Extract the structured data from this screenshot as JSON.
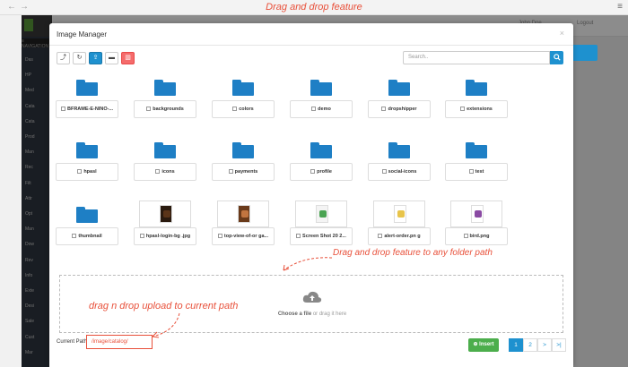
{
  "browser": {
    "back": "←",
    "forward": "→",
    "banner": "Drag and drop feature",
    "menu": "≡"
  },
  "app": {
    "logo": "HALAL PRO",
    "nav_header": "≡ NAVIGATION",
    "sidebar_items": [
      "Das",
      "HP",
      "Med",
      "Cata",
      "Cata",
      "Prod",
      "Man",
      "Rec",
      "Filt",
      "Attr",
      "Opt",
      "Man",
      "Dow",
      "Rev",
      "Info",
      "Exte",
      "Desi",
      "Sale",
      "Cust",
      "Mar"
    ],
    "user_name": "John Doe",
    "logout": "Logout"
  },
  "modal": {
    "title": "Image Manager",
    "close": "×",
    "toolbar": {
      "up": "⤴",
      "refresh": "↻",
      "upload": "⇪",
      "new_folder": "▬",
      "delete": "▥"
    },
    "search": {
      "placeholder": "Search.."
    },
    "items": [
      {
        "name": "BFRAME-E-NINO-...",
        "kind": "folder"
      },
      {
        "name": "backgrounds",
        "kind": "folder"
      },
      {
        "name": "colors",
        "kind": "folder"
      },
      {
        "name": "demo",
        "kind": "folder"
      },
      {
        "name": "dropshipper",
        "kind": "folder"
      },
      {
        "name": "extensions",
        "kind": "folder"
      },
      {
        "name": "hpasl",
        "kind": "folder"
      },
      {
        "name": "icons",
        "kind": "folder"
      },
      {
        "name": "payments",
        "kind": "folder"
      },
      {
        "name": "profile",
        "kind": "folder"
      },
      {
        "name": "social-icons",
        "kind": "folder"
      },
      {
        "name": "test",
        "kind": "folder"
      },
      {
        "name": "thumbnail",
        "kind": "folder"
      },
      {
        "name": "hpasl-login-bg .jpg",
        "kind": "image"
      },
      {
        "name": "top-view-of-or ga...",
        "kind": "image"
      },
      {
        "name": "Screen Shot 20 2...",
        "kind": "image"
      },
      {
        "name": "alert-order.pn g",
        "kind": "image"
      },
      {
        "name": "bird.png",
        "kind": "image"
      }
    ],
    "dropzone": {
      "choose": "Choose a file",
      "rest": " or drag it here"
    },
    "current_path_label": "Current Path:",
    "current_path": "/image/catalog/",
    "insert": "⊕ Insert",
    "pagination": [
      "1",
      "2",
      ">",
      ">|"
    ]
  },
  "annotations": {
    "folder": "Drag and drop feature to any folder path",
    "upload": "drag n drop upload to current path"
  },
  "colors": {
    "accent": "#1e91cf",
    "annotation": "#e8503a",
    "folder": "#1e7fc5",
    "insert": "#4cae4c",
    "delete": "#f56b6b"
  }
}
